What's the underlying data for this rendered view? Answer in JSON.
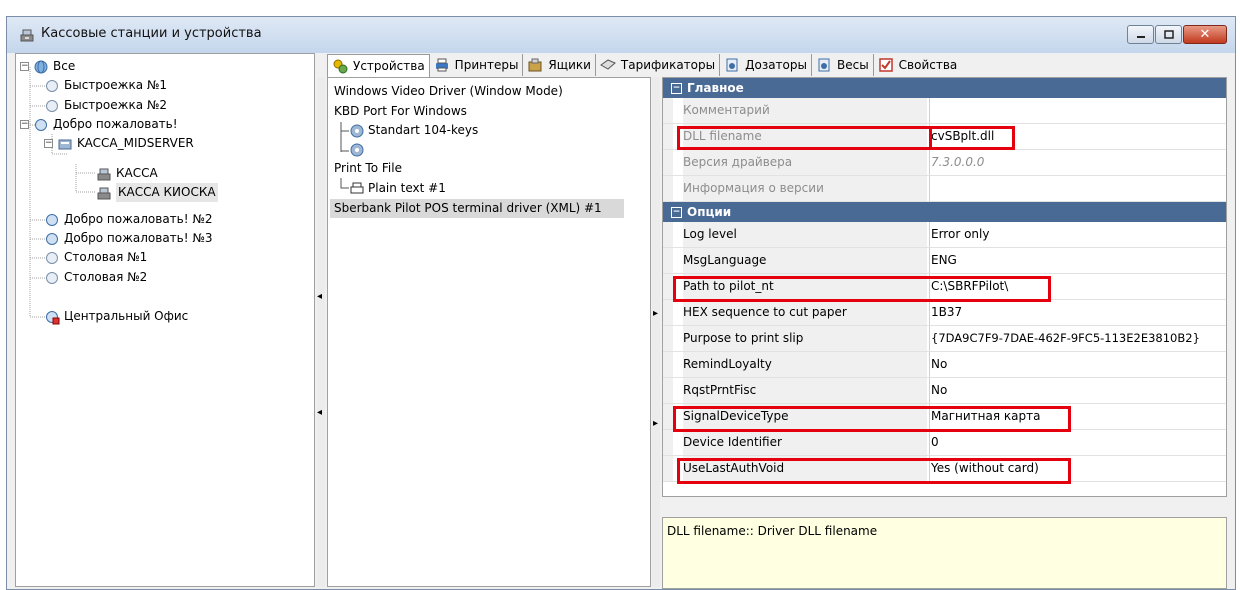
{
  "window": {
    "title": "Кассовые станции и устройства"
  },
  "tree": {
    "root": "Все",
    "items": [
      {
        "label": "Быстроежка №1"
      },
      {
        "label": "Быстроежка №2"
      },
      {
        "label": "Добро пожаловать!"
      },
      {
        "label": "KACCA_MIDSERVER"
      },
      {
        "label": "КАССА"
      },
      {
        "label": "КАССА КИОСКА"
      },
      {
        "label": "Добро пожаловать! №2"
      },
      {
        "label": "Добро пожаловать! №3"
      },
      {
        "label": "Столовая №1"
      },
      {
        "label": "Столовая №2"
      },
      {
        "label": "Центральный Офис"
      }
    ]
  },
  "tabs": [
    {
      "label": "Устройства",
      "icon": "devices-icon"
    },
    {
      "label": "Принтеры",
      "icon": "printer-icon"
    },
    {
      "label": "Ящики",
      "icon": "drawer-icon"
    },
    {
      "label": "Тарификаторы",
      "icon": "tariffer-icon"
    },
    {
      "label": "Дозаторы",
      "icon": "dispenser-icon"
    },
    {
      "label": "Весы",
      "icon": "scales-icon"
    },
    {
      "label": "Свойства",
      "icon": "properties-icon"
    }
  ],
  "devices": [
    {
      "label": "Windows Video Driver (Window Mode)"
    },
    {
      "label": "KBD Port For Windows"
    },
    {
      "label": "Standart 104-keys"
    },
    {
      "label": ""
    },
    {
      "label": "Print To File"
    },
    {
      "label": "Plain text #1"
    },
    {
      "label": "Sberbank Pilot POS terminal driver (XML) #1"
    }
  ],
  "properties": {
    "group_main": "Главное",
    "main_rows": [
      {
        "name": "Комментарий",
        "value": ""
      },
      {
        "name": "DLL filename",
        "value": "cvSBplt.dll"
      },
      {
        "name": "Версия драйвера",
        "value": "7.3.0.0.0"
      },
      {
        "name": "Информация о версии",
        "value": ""
      }
    ],
    "group_options": "Опции",
    "option_rows": [
      {
        "name": "Log level",
        "value": "Error only"
      },
      {
        "name": "MsgLanguage",
        "value": "ENG"
      },
      {
        "name": "Path to pilot_nt",
        "value": "C:\\SBRFPilot\\"
      },
      {
        "name": "HEX sequence to cut paper",
        "value": "1B37"
      },
      {
        "name": "Purpose to print slip",
        "value": "{7DA9C7F9-7DAE-462F-9FC5-113E2E3810B2}"
      },
      {
        "name": "RemindLoyalty",
        "value": "No"
      },
      {
        "name": "RqstPrntFisc",
        "value": "No"
      },
      {
        "name": "SignalDeviceType",
        "value": "Магнитная карта"
      },
      {
        "name": "Device Identifier",
        "value": "0"
      },
      {
        "name": "UseLastAuthVoid",
        "value": "Yes (without card)"
      }
    ]
  },
  "help": {
    "text": "DLL filename:: Driver DLL filename"
  },
  "colors": {
    "highlight": "#e5000d",
    "group_header": "#4a6a96",
    "help_bg": "#ffffe1"
  }
}
